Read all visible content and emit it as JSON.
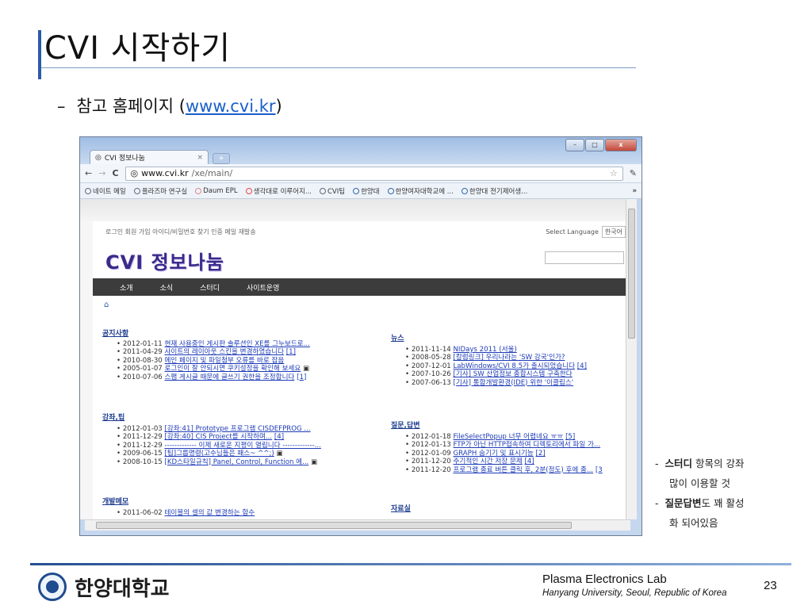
{
  "slide": {
    "title": "CVI 시작하기",
    "bullet": {
      "dash": "–",
      "text_before": "참고 홈페이지 (",
      "link": "www.cvi.kr",
      "text_after": ")"
    }
  },
  "browser": {
    "tab_title": "CVI 정보나눔",
    "tab_close": "×",
    "new_tab": "+",
    "controls": {
      "minimize": "–",
      "maximize": "□",
      "close": "x"
    },
    "nav": {
      "back": "←",
      "forward": "→",
      "reload": "C"
    },
    "url_host": "www.cvi.kr",
    "url_path": "/xe/main/",
    "star": "☆",
    "wrench": "🔧",
    "bookmarks": [
      "네이트 메일",
      "플라즈마 연구실",
      "Daum EPL",
      "생각대로 이루어지...",
      "CVI팁",
      "한양대",
      "한양여자대학교에 ...",
      "한양대 전기제어생..."
    ],
    "bookmarks_more": "»",
    "page": {
      "top_links": "로그인 회원 가입 아이디/비밀번호 찾기 인증 메일 재발송",
      "lang_label": "Select Language",
      "lang_value": "한국어",
      "logo": "CVI 정보나눔",
      "menu": [
        "소개",
        "소식",
        "스터디",
        "사이트운영"
      ],
      "home_icon": "⌂",
      "sections": {
        "notice": {
          "title": "공지사항",
          "items": [
            {
              "date": "2012-01-11",
              "text": "현재 사용중인 게시판 솔루션인 XE를 그누보드로..."
            },
            {
              "date": "2011-04-29",
              "text": "사이트의 레이아웃 스킨을 변경하였습니다",
              "count": "[1]"
            },
            {
              "date": "2010-08-30",
              "text": "메인 페이지 및 파일첨부 오류를 바로 잡음"
            },
            {
              "date": "2005-01-07",
              "text": "로그인이 잘 안되시면 쿠키설정을 확인해 보세요"
            },
            {
              "date": "2010-07-06",
              "text": "스팸 게시글 때문에 글쓰기 권한을 조정합니다",
              "count": "[1]"
            }
          ]
        },
        "lecture": {
          "title": "강좌,팁",
          "items": [
            {
              "date": "2012-01-03",
              "text": "[강좌:41] Prototype 프로그램 CISDEFPROG ..."
            },
            {
              "date": "2011-12-29",
              "text": "[강좌:40] CIS Project를 시작하며...",
              "count": "[4]"
            },
            {
              "date": "2011-12-29",
              "text": "------------- 이제 새로운 지평이 열립니다 -------------..."
            },
            {
              "date": "2009-06-15",
              "text": "[팁]그룹명령(고수님들은 패스~ ^^;)"
            },
            {
              "date": "2008-10-15",
              "text": "[KD스타일규칙] Panel, Control, Function 에..."
            }
          ]
        },
        "devmemo": {
          "title": "개발메모",
          "items": [
            {
              "date": "2011-06-02",
              "text": "테이블의 셀의 값 변경하는 함수"
            }
          ]
        },
        "news": {
          "title": "뉴스",
          "items": [
            {
              "date": "2011-11-14",
              "text": "NIDays 2011 (서울)"
            },
            {
              "date": "2008-05-28",
              "text": "[칼럼링크] 우리나라는 'SW 강국'인가?"
            },
            {
              "date": "2007-12-01",
              "text": "LabWindows/CVI 8.5가 출시되었습니다",
              "count": "[4]"
            },
            {
              "date": "2007-10-26",
              "text": "[기사] SW 산업정보 종합시스템 구축한다"
            },
            {
              "date": "2007-06-13",
              "text": "[기사] 통합개발환경(IDE) 위한 '이클립스'"
            }
          ]
        },
        "qna": {
          "title": "질문,답변",
          "items": [
            {
              "date": "2012-01-18",
              "text": "FileSelectPopup 너무 어렵네요 ㅠㅠ",
              "count": "[5]"
            },
            {
              "date": "2012-01-13",
              "text": "FTP가 아닌 HTTP접속하여 디렉토리에서 파일 가..."
            },
            {
              "date": "2012-01-09",
              "text": "GRAPH 숨기기 및 표시기능",
              "count": "[2]"
            },
            {
              "date": "2011-12-20",
              "text": "주기적인 시간 저장 문제",
              "count": "[4]"
            },
            {
              "date": "2011-12-20",
              "text": "프로그램 종료 버튼 클릭 후, 2분(정도) 후에 종...",
              "count": "[3"
            }
          ]
        },
        "archive": {
          "title": "자료실"
        }
      }
    }
  },
  "notes": [
    {
      "dash": "-",
      "bold": "스터디",
      "rest": " 항목의 강좌",
      "cont": "많이 이용할 것"
    },
    {
      "dash": "-",
      "bold": "질문답변",
      "rest": "도 꽤 활성",
      "cont": "화 되어있음"
    }
  ],
  "footer": {
    "univ": "한양대학교",
    "lab": "Plasma Electronics Lab",
    "lab_sub": "Hanyang University, Seoul, Republic of Korea",
    "page": "23"
  }
}
